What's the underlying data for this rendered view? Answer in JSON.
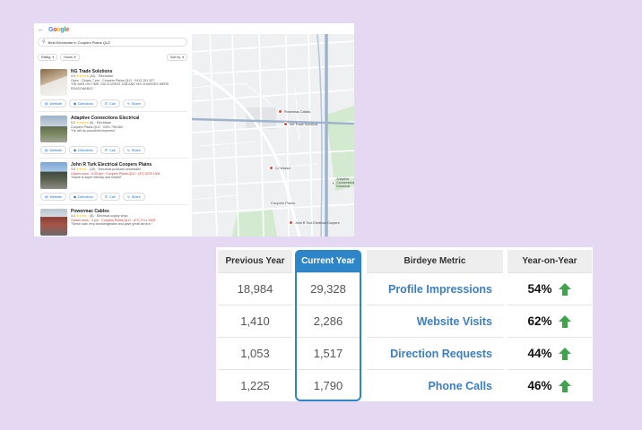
{
  "google": {
    "logo": "Google",
    "search_query": "Best Electrician in Coopers Plains QLD",
    "filters": [
      "Rating",
      "Hours"
    ],
    "sort_label": "Sort by",
    "results": [
      {
        "name": "NG Trade Solutions",
        "rating": "4.9",
        "stars": "★★★★★",
        "reviews": "(44)",
        "category": "Electrician",
        "status": "Open · Closes 7 pm · Coopers Plains QLD · 0413 151 327",
        "review": "\"HE WAS ON TIME, DID A GREAT JOB AND HIS CHARGES WERE REASONABLE.\""
      },
      {
        "name": "Adaptive Connections Electrical",
        "rating": "5.0",
        "stars": "★★★★★",
        "reviews": "(6)",
        "category": "Electrician",
        "status": "Coopers Plains QLD · 0491 798 663",
        "review": "\"He will do wonderful business\""
      },
      {
        "name": "John R Turk Electrical Coopers Plains",
        "rating": "3.9",
        "stars": "★★★★☆",
        "reviews": "(15)",
        "category": "Electrical products wholesaler",
        "status": "Closes soon · 4:30 pm · Coopers Plains QLD · (07) 3278 1304",
        "review": "\"Name is super friendly and helpful\""
      },
      {
        "name": "Powermac Cables",
        "rating": "4.4",
        "stars": "★★★★☆",
        "reviews": "(8)",
        "category": "Electrical supply shop",
        "status": "Closes soon · 4 pm · Coopers Plains QLD · (07) 3711 2425",
        "review": "\"Simon was very knowledgeable and gave great service.\""
      }
    ],
    "actions": {
      "website": "Website",
      "directions": "Directions",
      "call": "Call",
      "share": "Share"
    },
    "map_pins": [
      {
        "label": "Powermac Cables"
      },
      {
        "label": "NG Trade Solutions"
      },
      {
        "label": "CJ Wiresd"
      },
      {
        "label": "Adaptive Connections Electrical"
      },
      {
        "label": "John R Turk Electrical Coopers"
      },
      {
        "label": "Coopers Plains"
      }
    ]
  },
  "metrics": {
    "headers": {
      "previous": "Previous Year",
      "current": "Current Year",
      "metric": "Birdeye Metric",
      "yoy": "Year-on-Year"
    },
    "rows": [
      {
        "previous": "18,984",
        "current": "29,328",
        "metric": "Profile Impressions",
        "yoy": "54%"
      },
      {
        "previous": "1,410",
        "current": "2,286",
        "metric": "Website Visits",
        "yoy": "62%"
      },
      {
        "previous": "1,053",
        "current": "1,517",
        "metric": "Direction Requests",
        "yoy": "44%"
      },
      {
        "previous": "1,225",
        "current": "1,790",
        "metric": "Phone Calls",
        "yoy": "46%"
      }
    ],
    "arrow_color": "#3fa34d",
    "accent": "#2e86c9"
  }
}
